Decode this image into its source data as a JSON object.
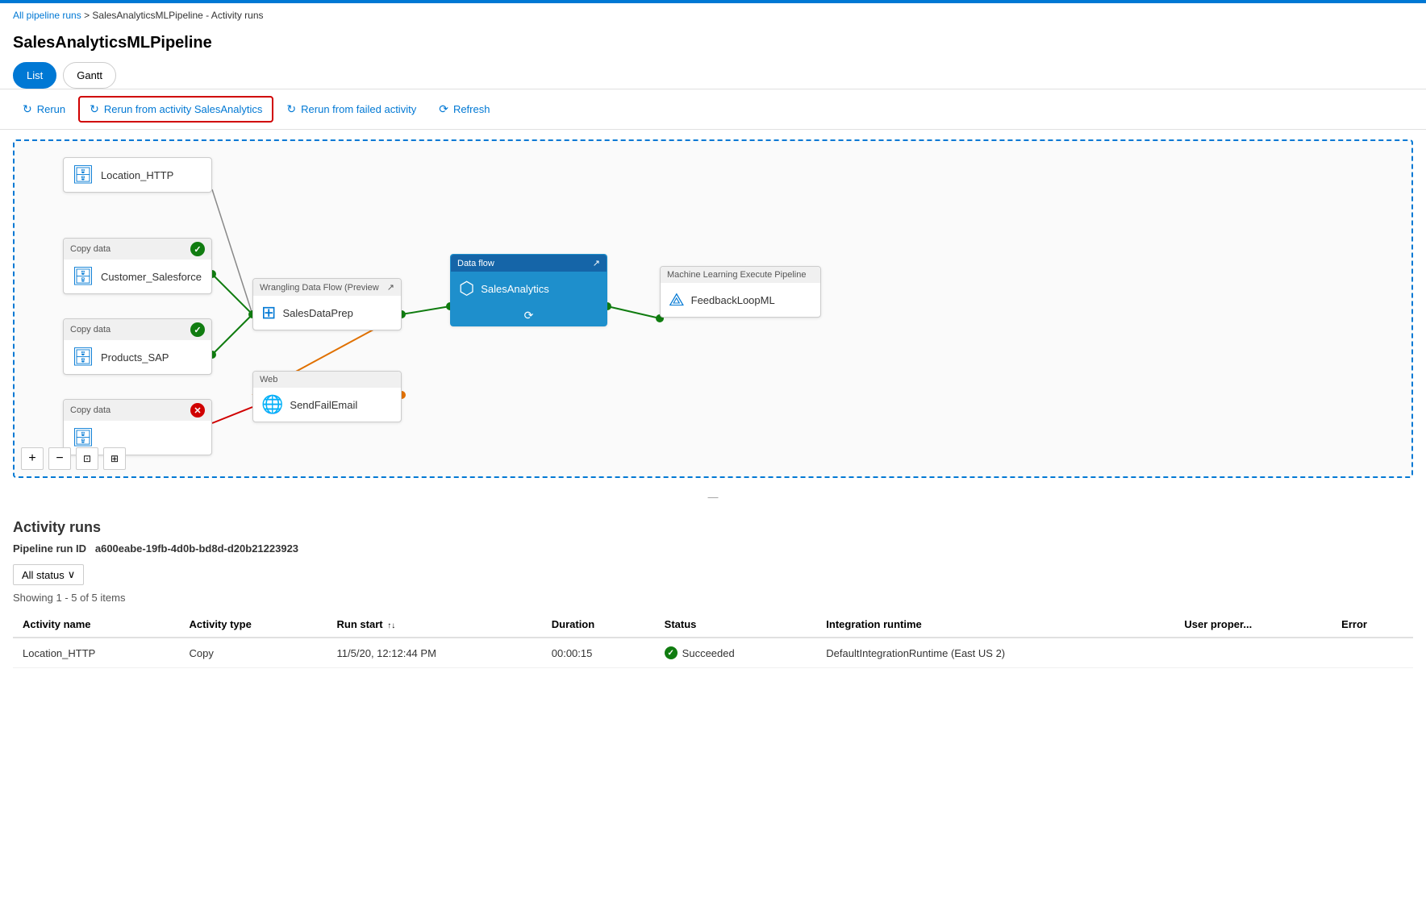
{
  "topBar": {},
  "breadcrumb": {
    "link": "All pipeline runs",
    "separator": " > ",
    "current": "SalesAnalyticsMLPipeline - Activity runs"
  },
  "pageTitle": "SalesAnalyticsMLPipeline",
  "tabs": [
    {
      "id": "list",
      "label": "List",
      "active": true
    },
    {
      "id": "gantt",
      "label": "Gantt",
      "active": false
    }
  ],
  "toolbar": {
    "rerun_label": "Rerun",
    "rerun_from_activity_label": "Rerun from activity SalesAnalytics",
    "rerun_from_failed_label": "Rerun from failed activity",
    "refresh_label": "Refresh"
  },
  "nodes": {
    "location": {
      "label": "Location_HTTP",
      "type": null
    },
    "customer": {
      "header": "Copy data",
      "label": "Customer_Salesforce",
      "status": "success"
    },
    "products": {
      "header": "Copy data",
      "label": "Products_SAP",
      "status": "success"
    },
    "copydata3": {
      "header": "Copy data",
      "label": "",
      "status": "error"
    },
    "salesdataprep": {
      "header": "Wrangling Data Flow (Preview",
      "label": "SalesDataPrep"
    },
    "sendfailemail": {
      "header": "Web",
      "label": "SendFailEmail"
    },
    "salesanalytics": {
      "header": "Data flow",
      "label": "SalesAnalytics"
    },
    "feedbackloop": {
      "header": "Machine Learning Execute Pipeline",
      "label": "FeedbackLoopML"
    }
  },
  "zoomControls": {
    "plus": "+",
    "minus": "−",
    "fit": "⊡",
    "grid": "⊞"
  },
  "activityRuns": {
    "title": "Activity runs",
    "runIdLabel": "Pipeline run ID",
    "runId": "a600eabe-19fb-4d0b-bd8d-d20b21223923",
    "filter": {
      "label": "All status",
      "chevron": "∨"
    },
    "showing": "Showing 1 - 5 of 5 items",
    "columns": [
      {
        "id": "name",
        "label": "Activity name"
      },
      {
        "id": "type",
        "label": "Activity type"
      },
      {
        "id": "runstart",
        "label": "Run start",
        "sortable": true,
        "sortIcon": "↑↓"
      },
      {
        "id": "duration",
        "label": "Duration"
      },
      {
        "id": "status",
        "label": "Status"
      },
      {
        "id": "runtime",
        "label": "Integration runtime"
      },
      {
        "id": "userprop",
        "label": "User proper..."
      },
      {
        "id": "error",
        "label": "Error"
      }
    ],
    "rows": [
      {
        "name": "Location_HTTP",
        "type": "Copy",
        "runstart": "11/5/20, 12:12:44 PM",
        "duration": "00:00:15",
        "status": "Succeeded",
        "statusType": "success",
        "runtime": "DefaultIntegrationRuntime (East US 2)",
        "userprop": "",
        "error": ""
      }
    ]
  }
}
